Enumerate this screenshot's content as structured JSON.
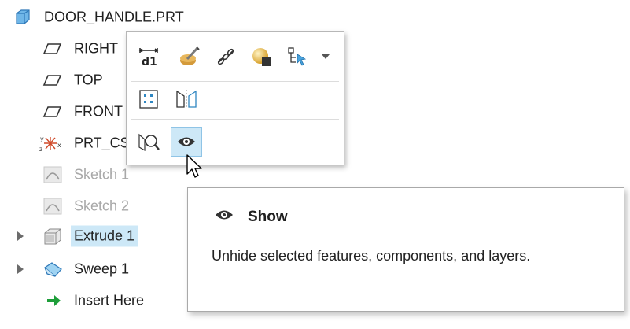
{
  "model_tree": {
    "root": {
      "label": "DOOR_HANDLE.PRT",
      "icon": "part-icon"
    },
    "items": [
      {
        "label": "RIGHT",
        "icon": "datum-plane-icon",
        "dimmed": false,
        "expandable": false
      },
      {
        "label": "TOP",
        "icon": "datum-plane-icon",
        "dimmed": false,
        "expandable": false
      },
      {
        "label": "FRONT",
        "icon": "datum-plane-icon",
        "dimmed": false,
        "expandable": false
      },
      {
        "label": "PRT_CS",
        "icon": "coordinate-system-icon",
        "dimmed": false,
        "expandable": false
      },
      {
        "label": "Sketch 1",
        "icon": "sketch-icon",
        "dimmed": true,
        "expandable": false
      },
      {
        "label": "Sketch 2",
        "icon": "sketch-icon",
        "dimmed": true,
        "expandable": false
      },
      {
        "label": "Extrude 1",
        "icon": "extrude-icon",
        "dimmed": false,
        "expandable": true,
        "selected": true
      },
      {
        "label": "Sweep 1",
        "icon": "sweep-icon",
        "dimmed": false,
        "expandable": true
      },
      {
        "label": "Insert Here",
        "icon": "insert-arrow-icon",
        "dimmed": false,
        "expandable": false
      }
    ]
  },
  "mini_toolbar": {
    "row1": [
      "edit-dimensions-icon",
      "edit-definition-icon",
      "edit-references-icon",
      "appearance-icon",
      "select-tree-icon",
      "dropdown-arrow-icon"
    ],
    "row2": [
      "pattern-icon",
      "mirror-icon"
    ],
    "row3": [
      "zoom-to-selected-icon",
      "show-icon"
    ],
    "active_button": "show-icon"
  },
  "tooltip": {
    "icon": "show-icon",
    "title": "Show",
    "description": "Unhide selected features, components, and layers."
  },
  "colors": {
    "selection": "#cde8f7",
    "accent": "#2e86c1",
    "dim_text": "#a8a8a8"
  }
}
